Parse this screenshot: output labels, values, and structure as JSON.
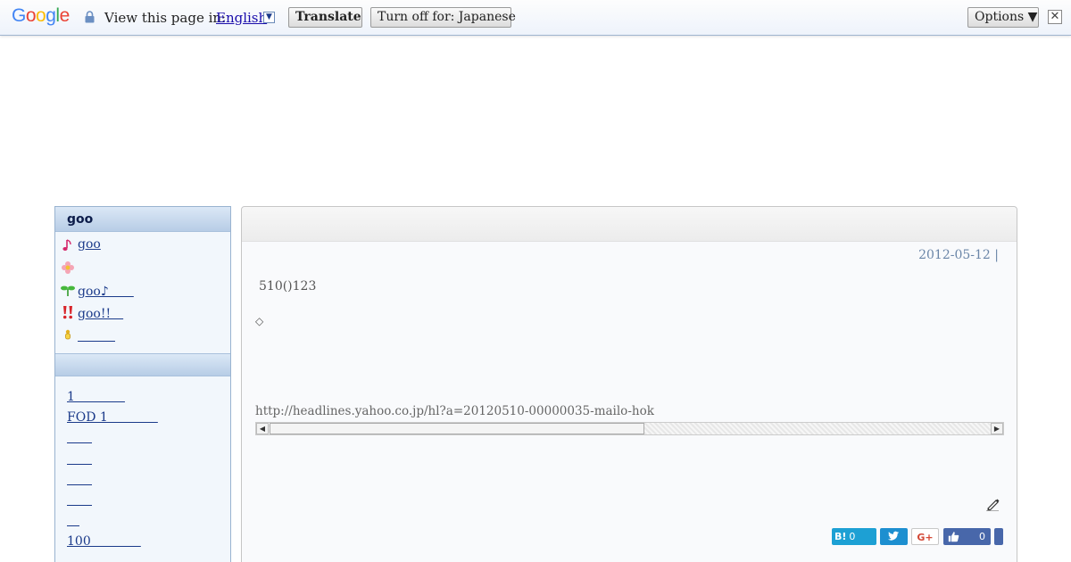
{
  "translate_bar": {
    "logo_text": "Google",
    "view_label": "View this page in:",
    "language": "English",
    "translate_label": "Translate",
    "turn_off_label": "Turn off for: Japanese",
    "options_label": "Options ▼",
    "close_glyph": "✕",
    "dropdown_glyph": "▼"
  },
  "sidebar": {
    "header": "goo",
    "items": [
      {
        "icon": "music-note-icon",
        "label": "goo"
      },
      {
        "icon": "flower-icon",
        "label": ""
      },
      {
        "icon": "sprout-icon",
        "label": "goo♪＿＿"
      },
      {
        "icon": "double-exclamation-icon",
        "label": "goo!!＿"
      },
      {
        "icon": "pin-icon",
        "label": "＿＿＿"
      }
    ],
    "section2_header": "",
    "links": [
      "1＿＿＿＿",
      "FOD 1＿＿＿＿",
      "＿＿",
      "＿＿",
      "＿＿",
      "＿＿",
      "＿",
      "100＿＿＿＿"
    ]
  },
  "article": {
    "date": "2012-05-12",
    "date_separator": "|",
    "title": "510()123",
    "diamond": "◇",
    "url": "http://headlines.yahoo.co.jp/hl?a=20120510-00000035-mailo-hok",
    "scrollbar_position": 0.0,
    "scrollbar_visible_fraction": 0.52
  },
  "share": {
    "hatena_logo": "B!",
    "hatena_count": "0",
    "tweet_icon": "twitter-bird-icon",
    "gplus_label": "G+",
    "fb_like_count": "0"
  },
  "colors": {
    "link": "#1b3a8a",
    "date": "#6b86a8",
    "hatena": "#1da0d4",
    "twitter": "#1d8fd0",
    "facebook": "#4867aa",
    "google_red": "#d34836"
  }
}
